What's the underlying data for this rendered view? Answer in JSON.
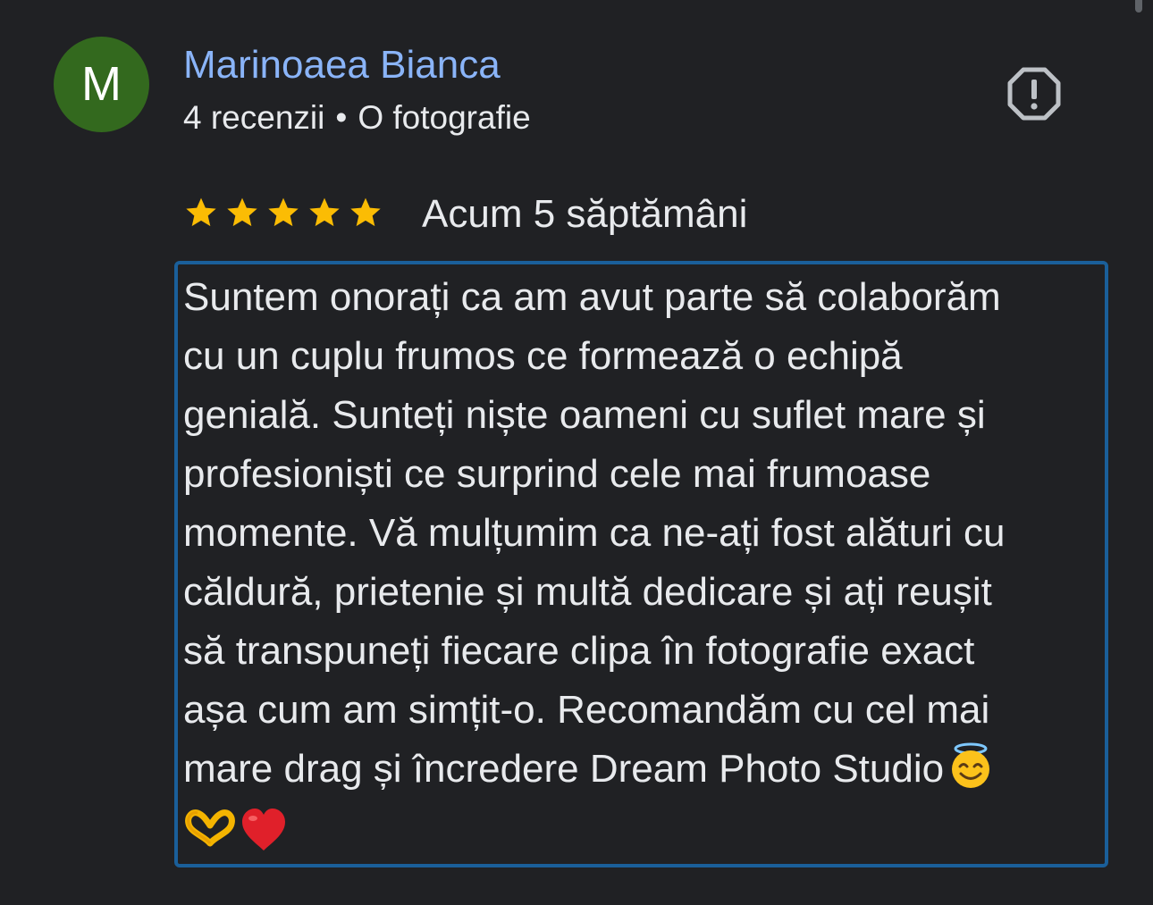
{
  "reviewer": {
    "avatar_letter": "M",
    "avatar_color": "#33691e",
    "name": "Marinoaea Bianca",
    "reviews_count": "4 recenzii",
    "separator": "•",
    "photos_count": "O fotografie"
  },
  "actions": {
    "report_icon": "report-flag-octagon-icon"
  },
  "rating": {
    "stars": 5,
    "max_stars": 5,
    "star_color": "#fbbc04",
    "date": "Acum 5 săptămâni"
  },
  "review": {
    "lines": [
      "Suntem onorați ca am avut parte să colaborăm",
      "cu un cuplu frumos ce formează o echipă",
      "genială. Sunteți niște oameni cu suflet mare și",
      "profesioniști ce surprind cele mai frumoase",
      "momente. Vă mulțumim ca ne-ați fost alături cu",
      "căldură, prietenie și multă dedicare și ați reușit",
      "să transpuneți fiecare clipa în fotografie exact",
      "așa cum am simțit-o. Recomandăm cu cel mai",
      "mare drag și încredere Dream Photo Studio"
    ],
    "emojis": [
      "smiling-face-with-halo",
      "heart-hands",
      "red-heart"
    ],
    "highlight_color": "#1a5f9a"
  }
}
